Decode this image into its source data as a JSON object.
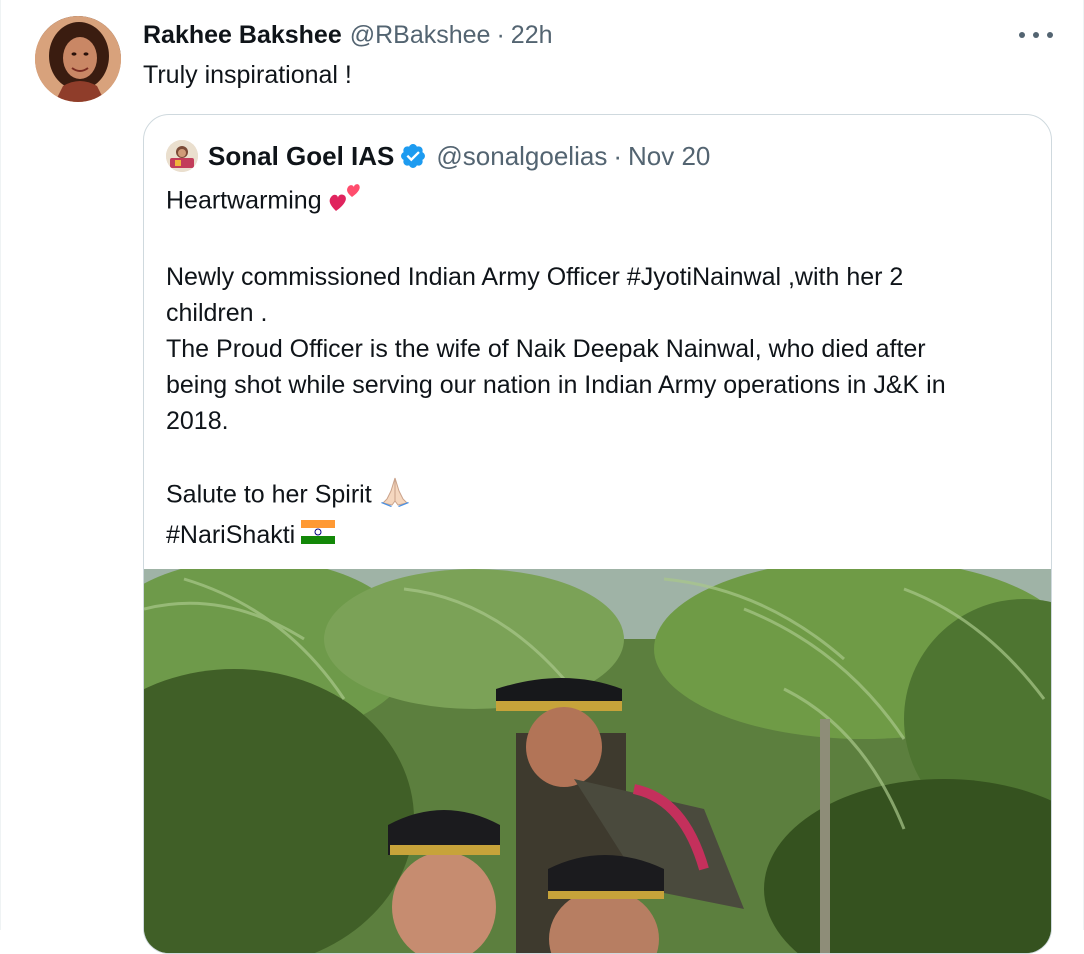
{
  "tweet": {
    "author_name": "Rakhee Bakshee",
    "author_handle": "@RBakshee",
    "separator": "·",
    "time": "22h",
    "text": "Truly inspirational !",
    "avatar_icon": "profile-photo",
    "more_icon": "more-dots-icon"
  },
  "quoted": {
    "author_name": "Sonal Goel IAS",
    "author_handle": "@sonalgoelias",
    "separator": "·",
    "time": "Nov 20",
    "verified_icon": "verified-badge-icon",
    "lines": [
      "Heartwarming",
      "Newly commissioned Indian Army Officer #JyotiNainwal ,with her 2",
      "children .",
      "The Proud Officer is the wife of Naik Deepak Nainwal, who died after",
      "being shot while serving our nation in Indian Army operations in J&K in",
      "2018.",
      "Salute to her Spirit",
      "#NariShakti"
    ],
    "emoji_icons": [
      "two-hearts-emoji",
      "folded-hands-emoji",
      "india-flag-emoji"
    ],
    "media_icon": "photo-army-officer-with-children"
  },
  "colors": {
    "text": "#0f1419",
    "secondary": "#536471",
    "border": "#cfd9de",
    "verified": "#1d9bf0"
  }
}
